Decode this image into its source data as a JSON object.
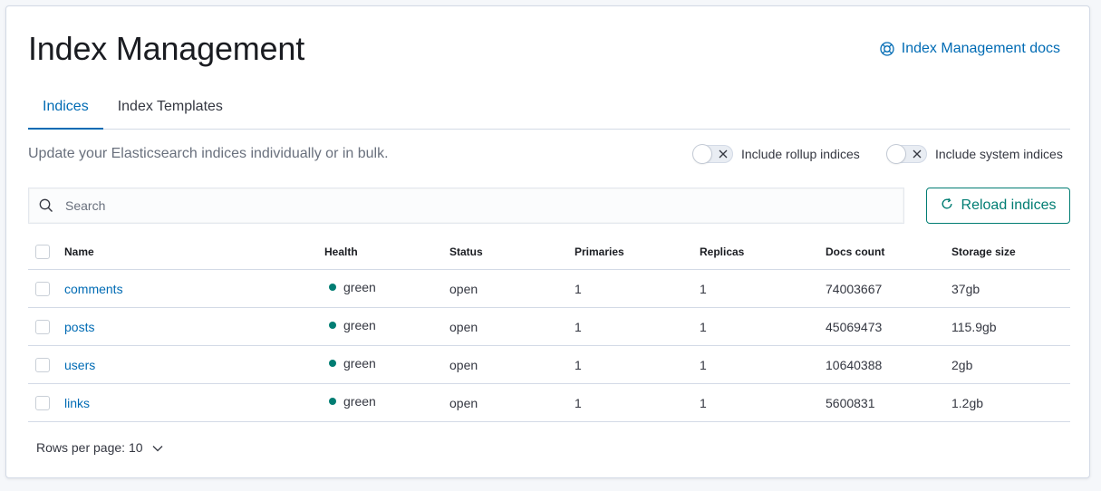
{
  "header": {
    "title": "Index Management",
    "docs_link": "Index Management docs"
  },
  "tabs": [
    {
      "label": "Indices",
      "selected": true
    },
    {
      "label": "Index Templates",
      "selected": false
    }
  ],
  "toolbar": {
    "description": "Update your Elasticsearch indices individually or in bulk.",
    "rollup_switch_label": "Include rollup indices",
    "system_switch_label": "Include system indices",
    "search_placeholder": "Search",
    "reload_label": "Reload indices"
  },
  "table": {
    "columns": [
      "Name",
      "Health",
      "Status",
      "Primaries",
      "Replicas",
      "Docs count",
      "Storage size"
    ],
    "rows": [
      {
        "name": "comments",
        "health": "green",
        "status": "open",
        "primaries": "1",
        "replicas": "1",
        "docs_count": "74003667",
        "storage_size": "37gb"
      },
      {
        "name": "posts",
        "health": "green",
        "status": "open",
        "primaries": "1",
        "replicas": "1",
        "docs_count": "45069473",
        "storage_size": "115.9gb"
      },
      {
        "name": "users",
        "health": "green",
        "status": "open",
        "primaries": "1",
        "replicas": "1",
        "docs_count": "10640388",
        "storage_size": "2gb"
      },
      {
        "name": "links",
        "health": "green",
        "status": "open",
        "primaries": "1",
        "replicas": "1",
        "docs_count": "5600831",
        "storage_size": "1.2gb"
      }
    ]
  },
  "pagination": {
    "rows_per_page": "Rows per page: 10"
  },
  "colors": {
    "link": "#006bb4",
    "primary": "#017d73",
    "health_green": "#017d73",
    "border": "#d3dae6"
  },
  "icons": {
    "docs": "help-lifebuoy-icon",
    "search": "search-icon",
    "reload": "refresh-icon",
    "switch_off": "close-icon",
    "pagination": "chevron-down-icon"
  }
}
